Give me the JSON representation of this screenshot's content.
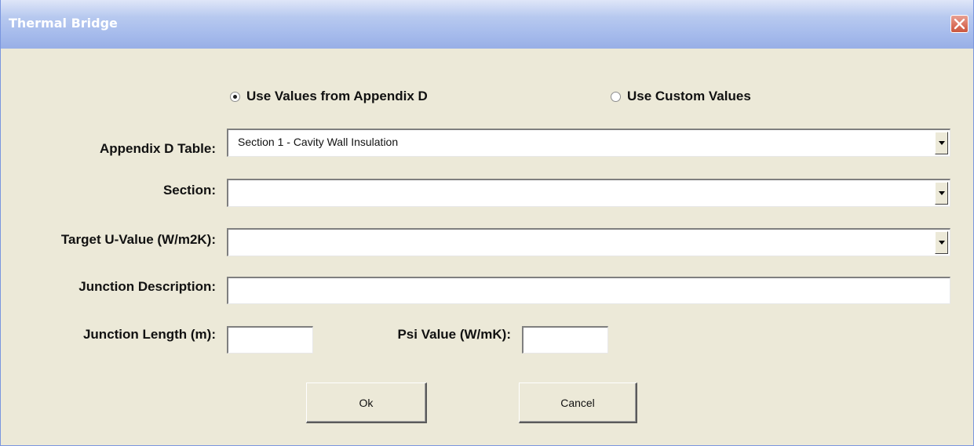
{
  "window": {
    "title": "Thermal Bridge"
  },
  "mode": {
    "options": [
      {
        "label": "Use Values from Appendix D",
        "selected": true
      },
      {
        "label": "Use Custom Values",
        "selected": false
      }
    ]
  },
  "form": {
    "appendix_table": {
      "label": "Appendix D Table:",
      "value": "Section 1 - Cavity Wall Insulation"
    },
    "section": {
      "label": "Section:",
      "value": ""
    },
    "target_u_value": {
      "label": "Target U-Value (W/m2K):",
      "value": ""
    },
    "junction_description": {
      "label": "Junction Description:",
      "value": ""
    },
    "junction_length": {
      "label": "Junction Length (m):",
      "value": ""
    },
    "psi_value": {
      "label": "Psi Value (W/mK):",
      "value": ""
    }
  },
  "buttons": {
    "ok_label": "Ok",
    "cancel_label": "Cancel"
  },
  "icons": {
    "close": "close-icon",
    "dropdown": "chevron-down-icon"
  },
  "colors": {
    "dialog_background": "#ece9d8",
    "titlebar": "#a6bbec",
    "close_button": "#d9705c"
  }
}
